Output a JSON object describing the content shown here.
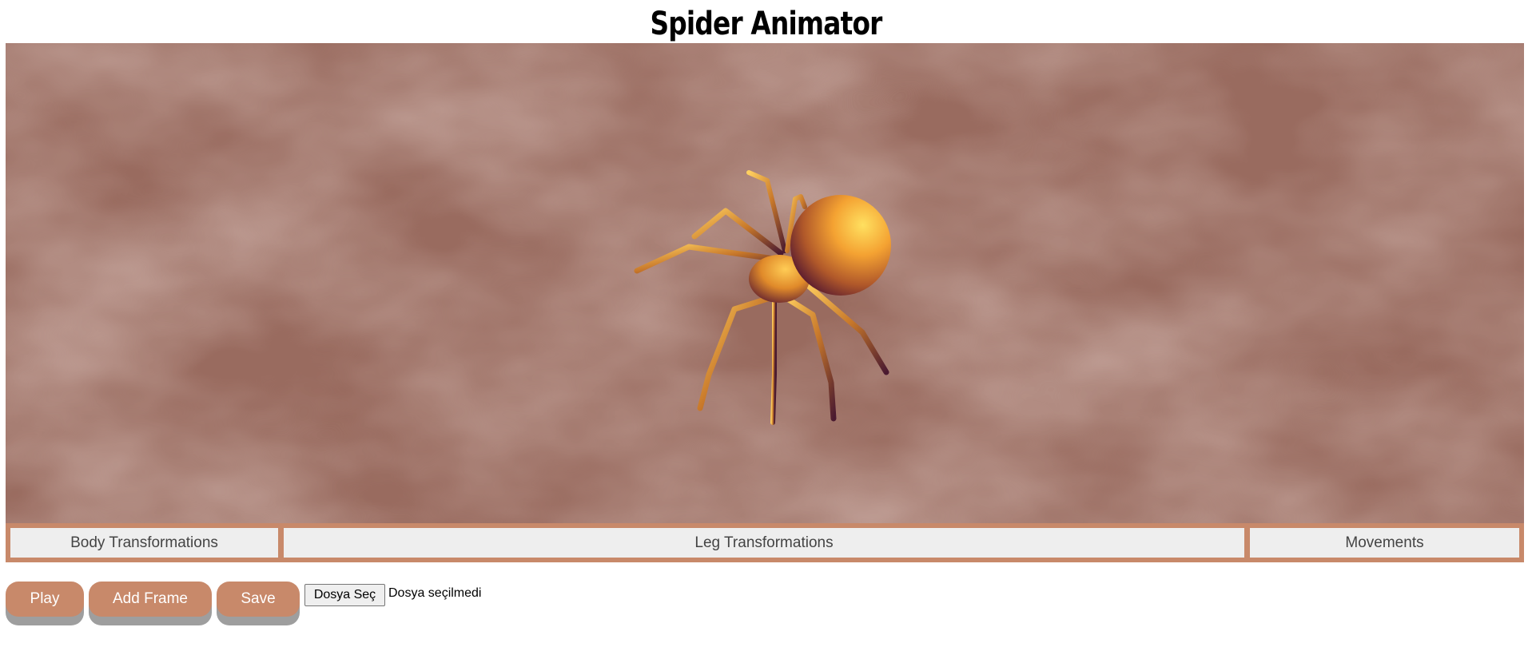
{
  "page": {
    "title": "Spider Animator"
  },
  "tabs": [
    {
      "label": "Body Transformations"
    },
    {
      "label": "Leg Transformations"
    },
    {
      "label": "Movements"
    }
  ],
  "controls": {
    "play_label": "Play",
    "add_frame_label": "Add Frame",
    "save_label": "Save",
    "file_button_label": "Dosya Seç",
    "file_status": "Dosya seçilmedi"
  },
  "colors": {
    "accent": "#c8896a",
    "background_sky": "#9b6e62",
    "spider_body": "#f0a030",
    "tab_bg": "#eeeeee"
  }
}
